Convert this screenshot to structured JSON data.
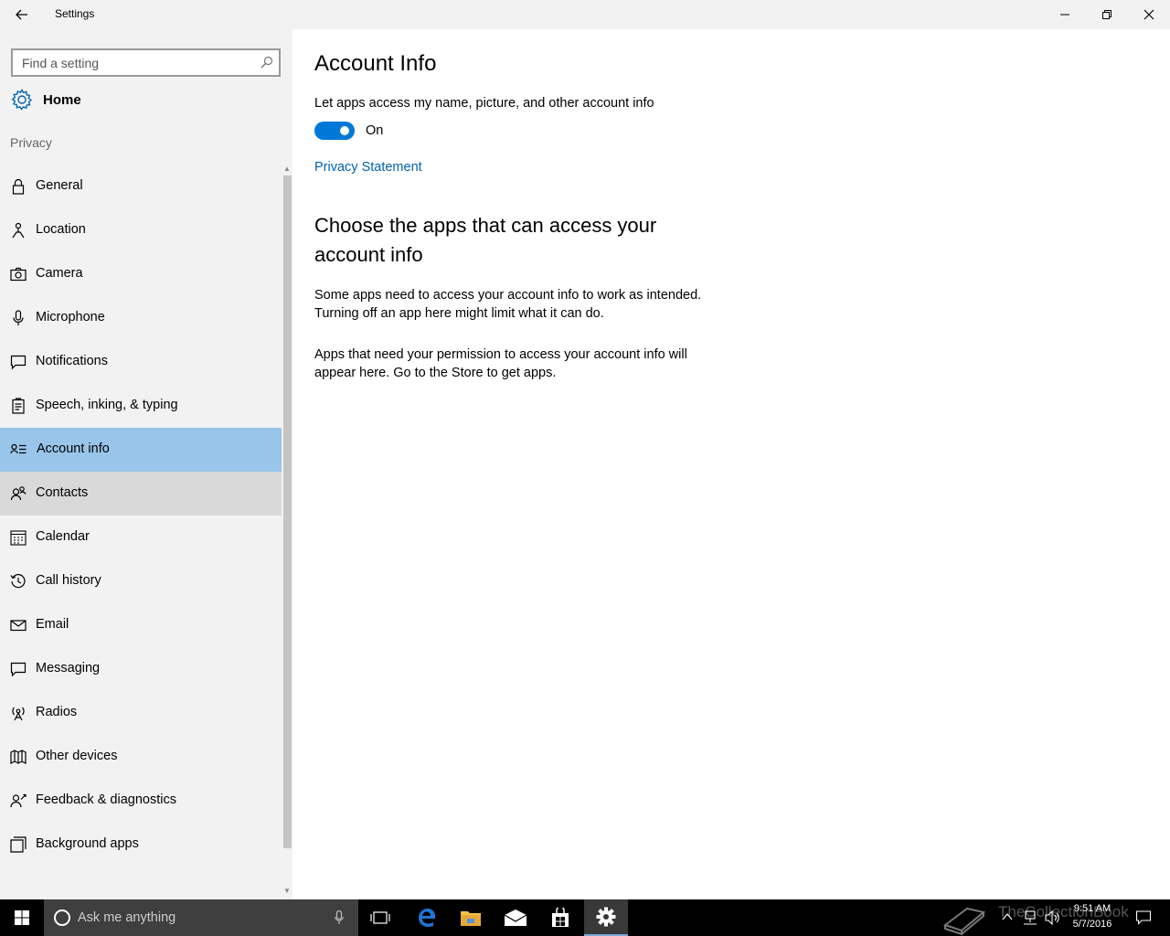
{
  "window": {
    "title": "Settings",
    "colors": {
      "accent": "#0078d7",
      "selected": "#99c5ea",
      "link": "#0063b1"
    }
  },
  "sidebar": {
    "search_placeholder": "Find a setting",
    "home_label": "Home",
    "section_label": "Privacy",
    "items": [
      {
        "label": "General",
        "icon": "lock-icon"
      },
      {
        "label": "Location",
        "icon": "location-icon"
      },
      {
        "label": "Camera",
        "icon": "camera-icon"
      },
      {
        "label": "Microphone",
        "icon": "microphone-icon"
      },
      {
        "label": "Notifications",
        "icon": "notifications-icon"
      },
      {
        "label": "Speech, inking, & typing",
        "icon": "speech-icon"
      },
      {
        "label": "Account info",
        "icon": "account-info-icon",
        "selected": true
      },
      {
        "label": "Contacts",
        "icon": "contacts-icon",
        "hover": true
      },
      {
        "label": "Calendar",
        "icon": "calendar-icon"
      },
      {
        "label": "Call history",
        "icon": "history-icon"
      },
      {
        "label": "Email",
        "icon": "email-icon"
      },
      {
        "label": "Messaging",
        "icon": "messaging-icon"
      },
      {
        "label": "Radios",
        "icon": "radios-icon"
      },
      {
        "label": "Other devices",
        "icon": "devices-icon"
      },
      {
        "label": "Feedback & diagnostics",
        "icon": "feedback-icon"
      },
      {
        "label": "Background apps",
        "icon": "background-apps-icon"
      }
    ]
  },
  "main": {
    "title": "Account Info",
    "toggle_description": "Let apps access my name, picture, and other account info",
    "toggle_state": "On",
    "privacy_link": "Privacy Statement",
    "subheading": "Choose the apps that can access your account info",
    "paragraph1": "Some apps need to access your account info to work as intended. Turning off an app here might limit what it can do.",
    "paragraph2": "Apps that need your permission to access your account info will appear here. Go to the Store to get apps."
  },
  "taskbar": {
    "search_placeholder": "Ask me anything",
    "time": "9:51 AM",
    "date": "5/7/2016",
    "watermark": "TheCollectionBook"
  }
}
